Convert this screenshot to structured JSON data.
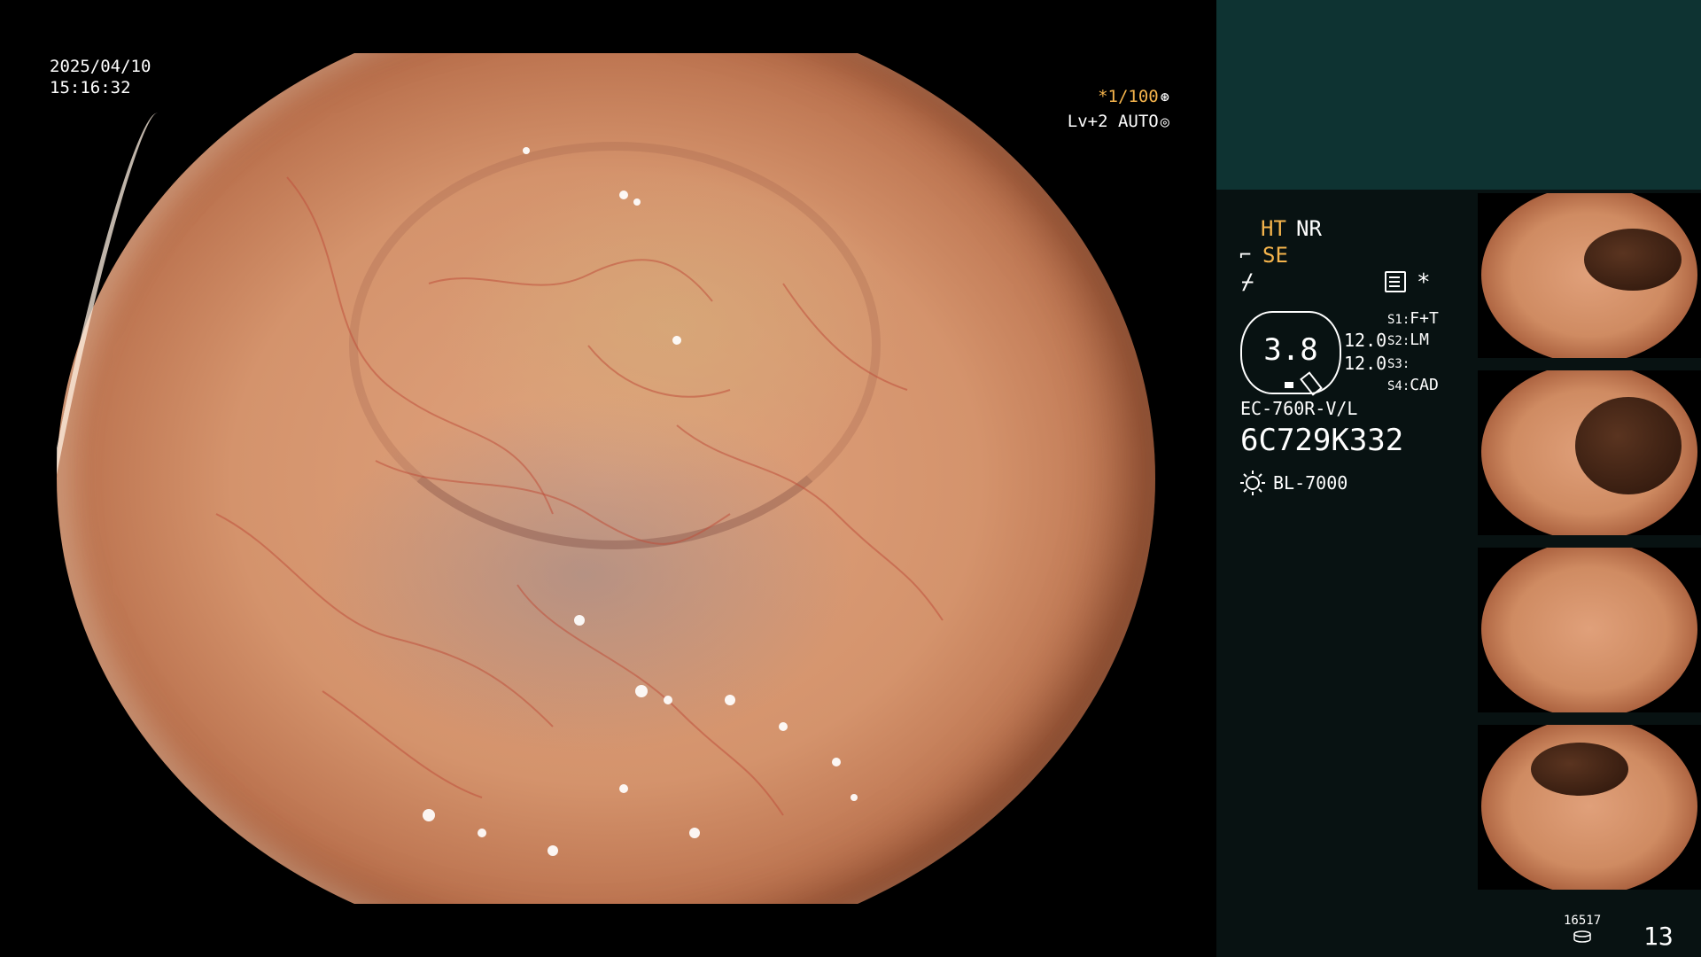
{
  "overlay": {
    "date": "2025/04/10",
    "time": "15:16:32",
    "shutter": "*1/100",
    "shutter_icon": "shutter-icon",
    "level": "Lv+2 AUTO",
    "level_icon": "iris-icon"
  },
  "panel": {
    "ht": "HT",
    "nr": "NR",
    "se": "SE",
    "se_icon": "⌐",
    "freeze_icon": "⌿",
    "star": "*",
    "gauge_value": "3.8",
    "value_a": "12.0",
    "value_b": "12.0",
    "slots": [
      {
        "key": "S1:",
        "value": "F+T"
      },
      {
        "key": "S2:",
        "value": "LM"
      },
      {
        "key": "S3:",
        "value": ""
      },
      {
        "key": "S4:",
        "value": "CAD"
      }
    ],
    "model": "EC-760R-V/L",
    "serial": "6C729K332",
    "light_source": "BL-7000",
    "image_count": "16517",
    "page_number": "13"
  },
  "colors": {
    "accent_orange": "#f5b44c",
    "panel_bg": "#081212",
    "panel_top": "#0e3332"
  }
}
